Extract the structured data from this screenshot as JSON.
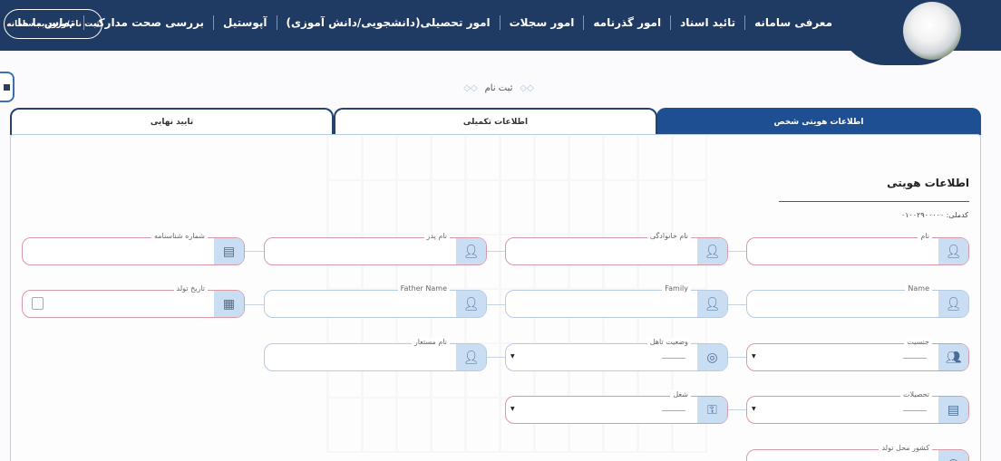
{
  "header": {
    "nav": [
      "معرفی سامانه",
      "تائید اسناد",
      "امور گذرنامه",
      "امور سجلات",
      "امور تحصیلی(دانشجویی/دانش آموزی)",
      "آپوستیل",
      "بررسی صحت مدارک",
      "تماس با ما"
    ],
    "signin_label": "ثبت نام/ورود به سامانه",
    "logo_icon": "flower-logo-icon"
  },
  "page": {
    "title": "ثبت نام",
    "tabs": [
      "اطلاعات هویتی شخص",
      "اطلاعات تکمیلی",
      "تایید نهایی"
    ],
    "active_tab": 0,
    "section_title": "اطلاعات هویتی",
    "code_label": "کدملی: ۰۱۰۰۲۹۰۰۰۰۰"
  },
  "fields": {
    "first_name": {
      "label": "نام",
      "icon": "user-icon"
    },
    "last_name": {
      "label": "نام خانوادگی",
      "icon": "user-icon"
    },
    "father_name": {
      "label": "نام پدر",
      "icon": "user-icon"
    },
    "id_number": {
      "label": "شماره شناسنامه",
      "icon": "id-card-icon"
    },
    "name_en": {
      "label": "Name",
      "icon": "user-icon"
    },
    "family_en": {
      "label": "Family",
      "icon": "user-icon"
    },
    "father_name_en": {
      "label": "Father Name",
      "icon": "user-icon"
    },
    "birth_date": {
      "label": "تاریخ تولد",
      "icon": "calendar-icon"
    },
    "gender": {
      "label": "جنسیت",
      "icon": "gender-icon"
    },
    "marital_status": {
      "label": "وضعیت تاهل",
      "icon": "rings-icon"
    },
    "alias_name": {
      "label": "نام مستعار",
      "icon": "user-icon"
    },
    "education": {
      "label": "تحصیلات",
      "icon": "graduation-icon"
    },
    "job": {
      "label": "شغل",
      "icon": "job-icon"
    },
    "birth_country": {
      "label": "کشور محل تولد",
      "icon": "globe-icon"
    }
  },
  "colors": {
    "navy": "#1f3a63",
    "active_tab": "#1e4f93",
    "field_border": "#d79aa6",
    "icon_bg": "#c9ddf3"
  }
}
